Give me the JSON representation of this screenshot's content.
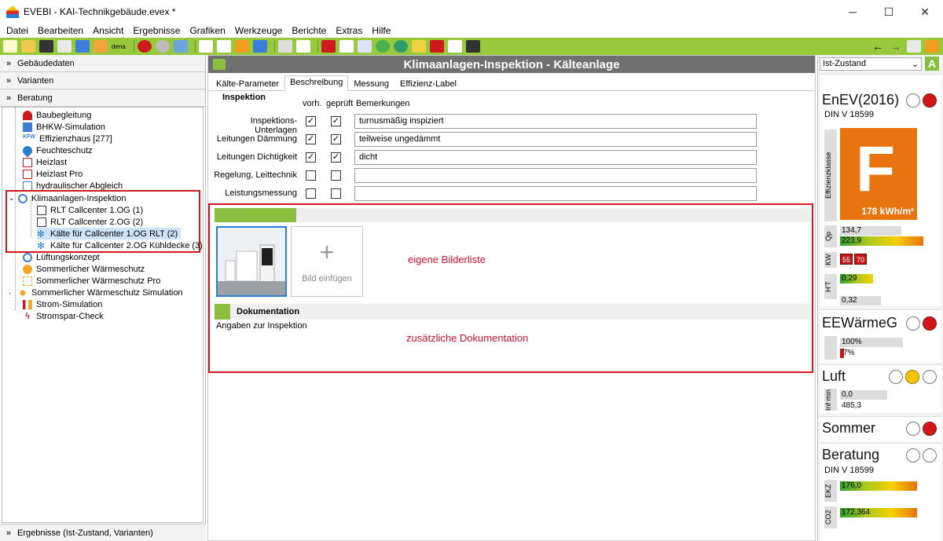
{
  "window": {
    "title": "EVEBI - KAI-Technikgebäude.evex *",
    "minimize_icon": "─",
    "maximize_icon": "☐",
    "close_icon": "✕"
  },
  "menu": [
    "Datei",
    "Bearbeiten",
    "Ansicht",
    "Ergebnisse",
    "Grafiken",
    "Werkzeuge",
    "Berichte",
    "Extras",
    "Hilfe"
  ],
  "toolbar": {
    "dena_label": "dena"
  },
  "sidebar": {
    "sections": [
      "Gebäudedaten",
      "Varianten",
      "Beratung"
    ],
    "tree": [
      "Baubegleitung",
      "BHKW-Simulation",
      "Effizienzhaus [277]",
      "Feuchteschutz",
      "Heizlast",
      "Heizlast Pro",
      "hydraulischer Abgleich",
      "Klimaanlagen-Inspektion",
      "RLT Callcenter 1.OG (1)",
      "RLT Callcenter 2.OG (2)",
      "Kälte für Callcenter 1.OG RLT (2)",
      "Kälte für Callcenter 2.OG Kühldecke (3)",
      "Lüftungskonzept",
      "Sommerlicher Wärmeschutz",
      "Sommerlicher Wärmeschutz Pro",
      "Sommerlicher Wärmeschutz Simulation",
      "Strom-Simulation",
      "Stromspar-Check"
    ],
    "kfw_label": "KFW",
    "bottom": "Ergebnisse (Ist-Zustand, Varianten)"
  },
  "main": {
    "title": "Klimaanlagen-Inspektion - Kälteanlage",
    "tabs": [
      "Kälte-Parameter",
      "Beschreibung",
      "Messung",
      "Effizienz-Label"
    ],
    "inspection_header": "Inspektion",
    "col_vorh": "vorh.",
    "col_geprueft": "geprüft",
    "col_bemerkungen": "Bemerkungen",
    "rows": [
      {
        "label": "Inspektions-Unterlagen",
        "vorh": true,
        "geprueft": true,
        "remark": "turnusmäßig inspiziert"
      },
      {
        "label": "Leitungen Dämmung",
        "vorh": true,
        "geprueft": true,
        "remark": "teilweise ungedämmt"
      },
      {
        "label": "Leitungen Dichtigkeit",
        "vorh": true,
        "geprueft": true,
        "remark": "dicht"
      },
      {
        "label": "Regelung, Leittechnik",
        "vorh": false,
        "geprueft": false,
        "remark": ""
      },
      {
        "label": "Leistungsmessung",
        "vorh": false,
        "geprueft": false,
        "remark": ""
      }
    ],
    "add_image": "Bild einfügen",
    "plus_icon": "+",
    "annotation_images": "eigene Bilderliste",
    "doc_header": "Dokumentation",
    "doc_text": "Angaben zur Inspektion",
    "annotation_doc": "zusätzliche Dokumentation"
  },
  "right": {
    "state_select": "Ist-Zustand",
    "a_badge": "A",
    "enev": {
      "title": "EnEV(2016)",
      "norm": "DIN V 18599",
      "eff_label": "Effizienzklasse",
      "eff_class": "F",
      "eff_value": "178 kWh/m²",
      "qp_label": "Qp",
      "qp1": "134,7",
      "qp2": "223,9",
      "kw_label": "KW",
      "kw1": "55",
      "kw2": "70",
      "ht_label": "H'T",
      "ht1": "0,29",
      "ht2": "0,32"
    },
    "ee": {
      "title": "EEWärmeG",
      "v1": "100%",
      "v2": "7%"
    },
    "luft": {
      "title": "Luft",
      "label": "Inf min",
      "v1": "0,0",
      "v2": "485,3"
    },
    "sommer": {
      "title": "Sommer"
    },
    "beratung": {
      "title": "Beratung",
      "norm": "DIN V 18599",
      "ekz_label": "EKZ",
      "ekz": "176,0",
      "co2_label": "CO2",
      "co2": "172,364"
    }
  },
  "colors": {
    "toolbar": "#97c93d",
    "header": "#707070",
    "highlight": "#d0191c",
    "efficiency": "#e8740f"
  }
}
